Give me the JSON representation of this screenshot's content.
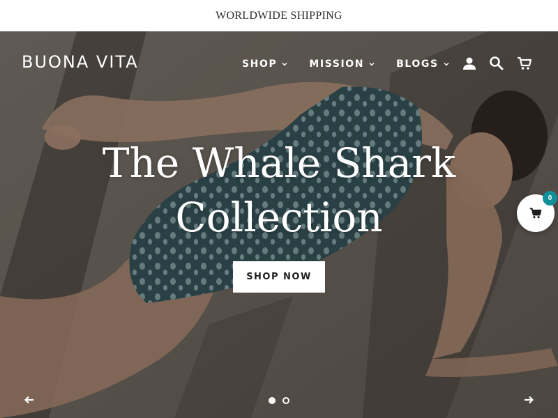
{
  "announcement": {
    "text": "WORLDWIDE SHIPPING"
  },
  "header": {
    "logo": "BUONA VITA",
    "nav": [
      {
        "label": "SHOP"
      },
      {
        "label": "MISSION"
      },
      {
        "label": "BLOGS"
      }
    ],
    "icons": [
      "account-icon",
      "search-icon",
      "cart-icon"
    ]
  },
  "hero": {
    "title_line1": "The Whale Shark",
    "title_line2": "Collection",
    "cta_label": "SHOP NOW",
    "slides_total": 2,
    "slide_active": 1
  },
  "floating_cart": {
    "count": "0"
  },
  "colors": {
    "accent": "#12909a",
    "overlay": "#4d4741",
    "text_light": "#ffffff",
    "swimsuit": "#2f4f58"
  }
}
